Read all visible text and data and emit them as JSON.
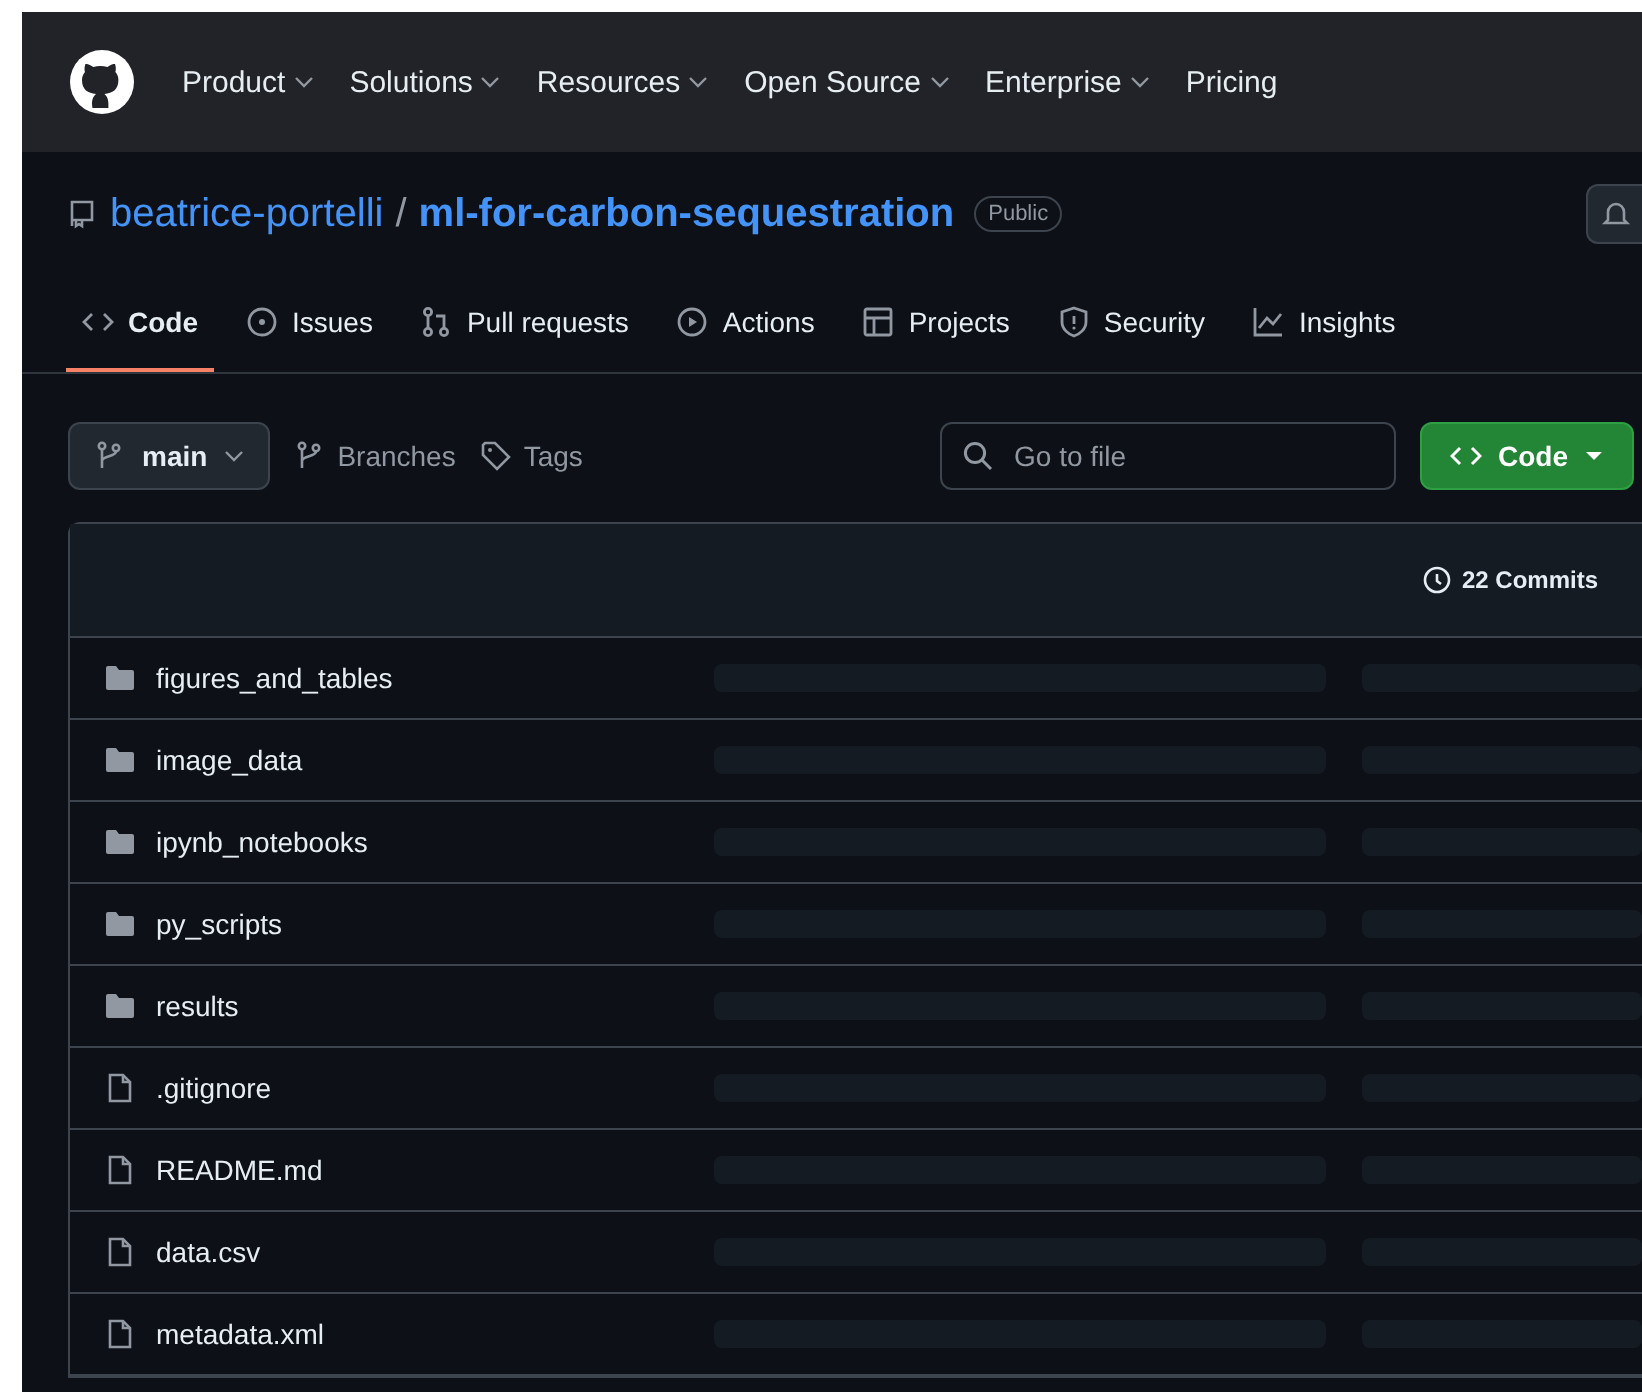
{
  "header": {
    "nav": [
      {
        "label": "Product",
        "dropdown": true
      },
      {
        "label": "Solutions",
        "dropdown": true
      },
      {
        "label": "Resources",
        "dropdown": true
      },
      {
        "label": "Open Source",
        "dropdown": true
      },
      {
        "label": "Enterprise",
        "dropdown": true
      },
      {
        "label": "Pricing",
        "dropdown": false
      }
    ]
  },
  "repo": {
    "owner": "beatrice-portelli",
    "separator": "/",
    "name": "ml-for-carbon-sequestration",
    "visibility": "Public"
  },
  "tabs": [
    {
      "label": "Code",
      "selected": true
    },
    {
      "label": "Issues",
      "selected": false
    },
    {
      "label": "Pull requests",
      "selected": false
    },
    {
      "label": "Actions",
      "selected": false
    },
    {
      "label": "Projects",
      "selected": false
    },
    {
      "label": "Security",
      "selected": false
    },
    {
      "label": "Insights",
      "selected": false
    }
  ],
  "toolbar": {
    "branch": "main",
    "branches": "Branches",
    "tags": "Tags",
    "search": {
      "placeholder": "Go to file"
    },
    "code_button": "Code"
  },
  "files": {
    "commits": "22 Commits",
    "rows": [
      {
        "name": "figures_and_tables",
        "kind": "folder"
      },
      {
        "name": "image_data",
        "kind": "folder"
      },
      {
        "name": "ipynb_notebooks",
        "kind": "folder"
      },
      {
        "name": "py_scripts",
        "kind": "folder"
      },
      {
        "name": "results",
        "kind": "folder"
      },
      {
        "name": ".gitignore",
        "kind": "file"
      },
      {
        "name": "README.md",
        "kind": "file"
      },
      {
        "name": "data.csv",
        "kind": "file"
      },
      {
        "name": "metadata.xml",
        "kind": "file"
      }
    ]
  }
}
